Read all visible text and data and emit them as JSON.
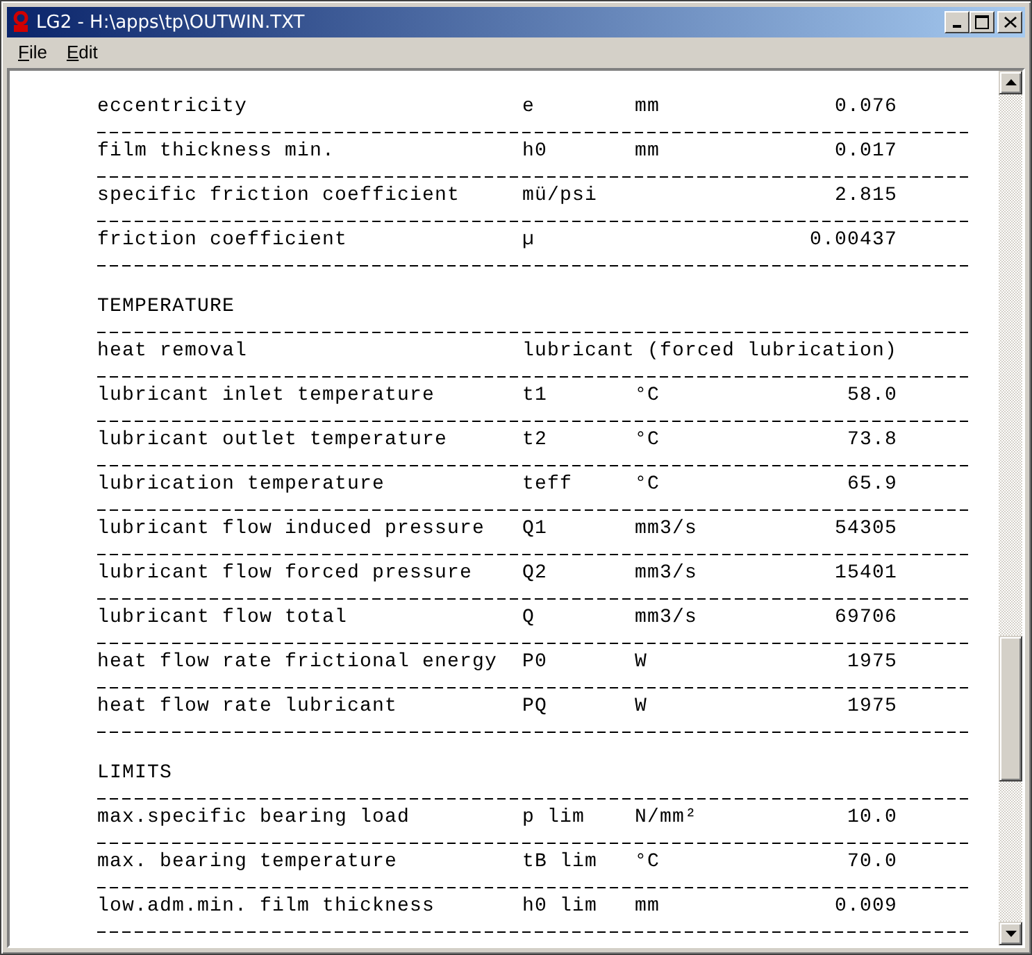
{
  "window": {
    "title": "LG2 - H:\\apps\\tp\\OUTWIN.TXT"
  },
  "menu": [
    {
      "label": "File"
    },
    {
      "label": "Edit"
    }
  ],
  "sections": [
    {
      "rows": [
        {
          "kind": "quantity",
          "label": "eccentricity",
          "symbol": "e",
          "unit": "mm",
          "value": "0.076"
        },
        {
          "kind": "quantity",
          "label": "film thickness min.",
          "symbol": "h0",
          "unit": "mm",
          "value": "0.017"
        },
        {
          "kind": "quantity",
          "label": "specific friction coefficient",
          "symbol": "mü/psi",
          "value": "2.815"
        },
        {
          "kind": "quantity",
          "label": "friction coefficient",
          "symbol": "µ",
          "value": "0.00437"
        }
      ]
    },
    {
      "title": "TEMPERATURE",
      "rows": [
        {
          "kind": "text",
          "label": "heat removal",
          "value": "lubricant (forced lubrication)"
        },
        {
          "kind": "quantity",
          "label": "lubricant inlet temperature",
          "symbol": "t1",
          "unit": "°C",
          "value": "58.0"
        },
        {
          "kind": "quantity",
          "label": "lubricant outlet temperature",
          "symbol": "t2",
          "unit": "°C",
          "value": "73.8"
        },
        {
          "kind": "quantity",
          "label": "lubrication temperature",
          "symbol": "teff",
          "unit": "°C",
          "value": "65.9"
        },
        {
          "kind": "quantity",
          "label": "lubricant flow induced pressure",
          "symbol": "Q1",
          "unit": "mm3/s",
          "value": "54305"
        },
        {
          "kind": "quantity",
          "label": "lubricant flow forced pressure",
          "symbol": "Q2",
          "unit": "mm3/s",
          "value": "15401"
        },
        {
          "kind": "quantity",
          "label": "lubricant flow total",
          "symbol": "Q",
          "unit": "mm3/s",
          "value": "69706"
        },
        {
          "kind": "quantity",
          "label": "heat flow rate frictional energy",
          "symbol": "P0",
          "unit": "W",
          "value": "1975"
        },
        {
          "kind": "quantity",
          "label": "heat flow rate lubricant",
          "symbol": "PQ",
          "unit": "W",
          "value": "1975"
        }
      ]
    },
    {
      "title": "LIMITS",
      "rows": [
        {
          "kind": "quantity",
          "label": "max.specific bearing load",
          "symbol": "p lim",
          "unit": "N/mm²",
          "value": "10.0"
        },
        {
          "kind": "quantity",
          "label": "max. bearing temperature",
          "symbol": "tB lim",
          "unit": "°C",
          "value": "70.0"
        },
        {
          "kind": "quantity",
          "label": "low.adm.min. film thickness",
          "symbol": "h0 lim",
          "unit": "mm",
          "value": "0.009"
        }
      ]
    }
  ]
}
